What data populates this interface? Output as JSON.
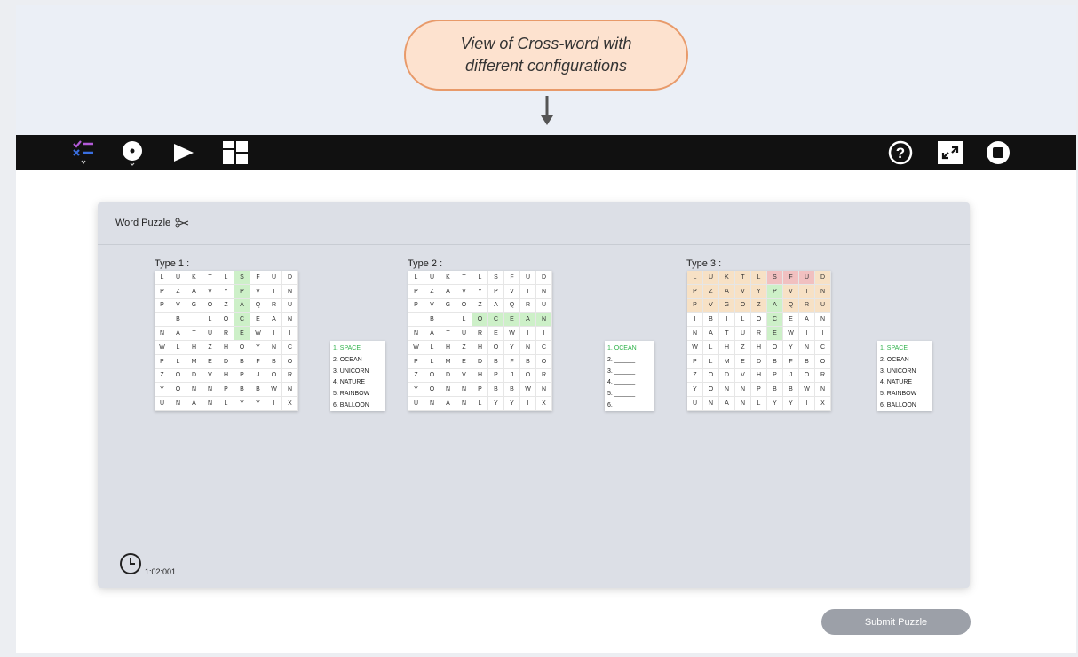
{
  "callout": {
    "line1": "View of Cross-word with",
    "line2": "different configurations"
  },
  "toolbar": {
    "left_icons": [
      "checklist-icon",
      "disc-icon",
      "play-icon",
      "grid-icon"
    ],
    "right_icons": [
      "help-icon",
      "expand-icon",
      "stop-icon"
    ],
    "help_glyph": "?"
  },
  "panel": {
    "title": "Word Puzzle",
    "title_icon": "scissors-icon"
  },
  "grid_letters": [
    [
      "L",
      "U",
      "K",
      "T",
      "L",
      "S",
      "F",
      "U",
      "D"
    ],
    [
      "P",
      "Z",
      "A",
      "V",
      "Y",
      "P",
      "V",
      "T",
      "N"
    ],
    [
      "P",
      "V",
      "G",
      "O",
      "Z",
      "A",
      "Q",
      "R",
      "U"
    ],
    [
      "I",
      "B",
      "I",
      "L",
      "O",
      "C",
      "E",
      "A",
      "N"
    ],
    [
      "N",
      "A",
      "T",
      "U",
      "R",
      "E",
      "W",
      "I",
      "I"
    ],
    [
      "W",
      "L",
      "H",
      "Z",
      "H",
      "O",
      "Y",
      "N",
      "C"
    ],
    [
      "P",
      "L",
      "M",
      "E",
      "D",
      "B",
      "F",
      "B",
      "O"
    ],
    [
      "Z",
      "O",
      "D",
      "V",
      "H",
      "P",
      "J",
      "O",
      "R"
    ],
    [
      "Y",
      "O",
      "N",
      "N",
      "P",
      "B",
      "B",
      "W",
      "N"
    ],
    [
      "U",
      "N",
      "A",
      "N",
      "L",
      "Y",
      "Y",
      "I",
      "X"
    ]
  ],
  "puzzles": [
    {
      "label": "Type 1 :",
      "words": [
        "1. SPACE",
        "2. OCEAN",
        "3. UNICORN",
        "4. NATURE",
        "5. RAINBOW",
        "6. BALLOON"
      ],
      "found": [
        0
      ],
      "highlight": "column"
    },
    {
      "label": "Type 2 :",
      "words": [
        "1. OCEAN",
        "2. ______",
        "3. ______",
        "4. ______",
        "5. ______",
        "6. ______"
      ],
      "found": [
        0
      ],
      "highlight": "row"
    },
    {
      "label": "Type 3 :",
      "words": [
        "1. SPACE",
        "2. OCEAN",
        "3. UNICORN",
        "4. NATURE",
        "5. RAINBOW",
        "6. BALLOON"
      ],
      "found": [
        0
      ],
      "highlight": "column-art"
    }
  ],
  "timer": {
    "icon": "clock-icon",
    "value": "1:02:001"
  },
  "submit_label": "Submit Puzzle",
  "colors": {
    "found": "#2fb24a",
    "highlight": "#cdf0c8",
    "toolbar": "#111111",
    "callout_bg": "#fde2cf",
    "callout_border": "#e89a6a"
  }
}
